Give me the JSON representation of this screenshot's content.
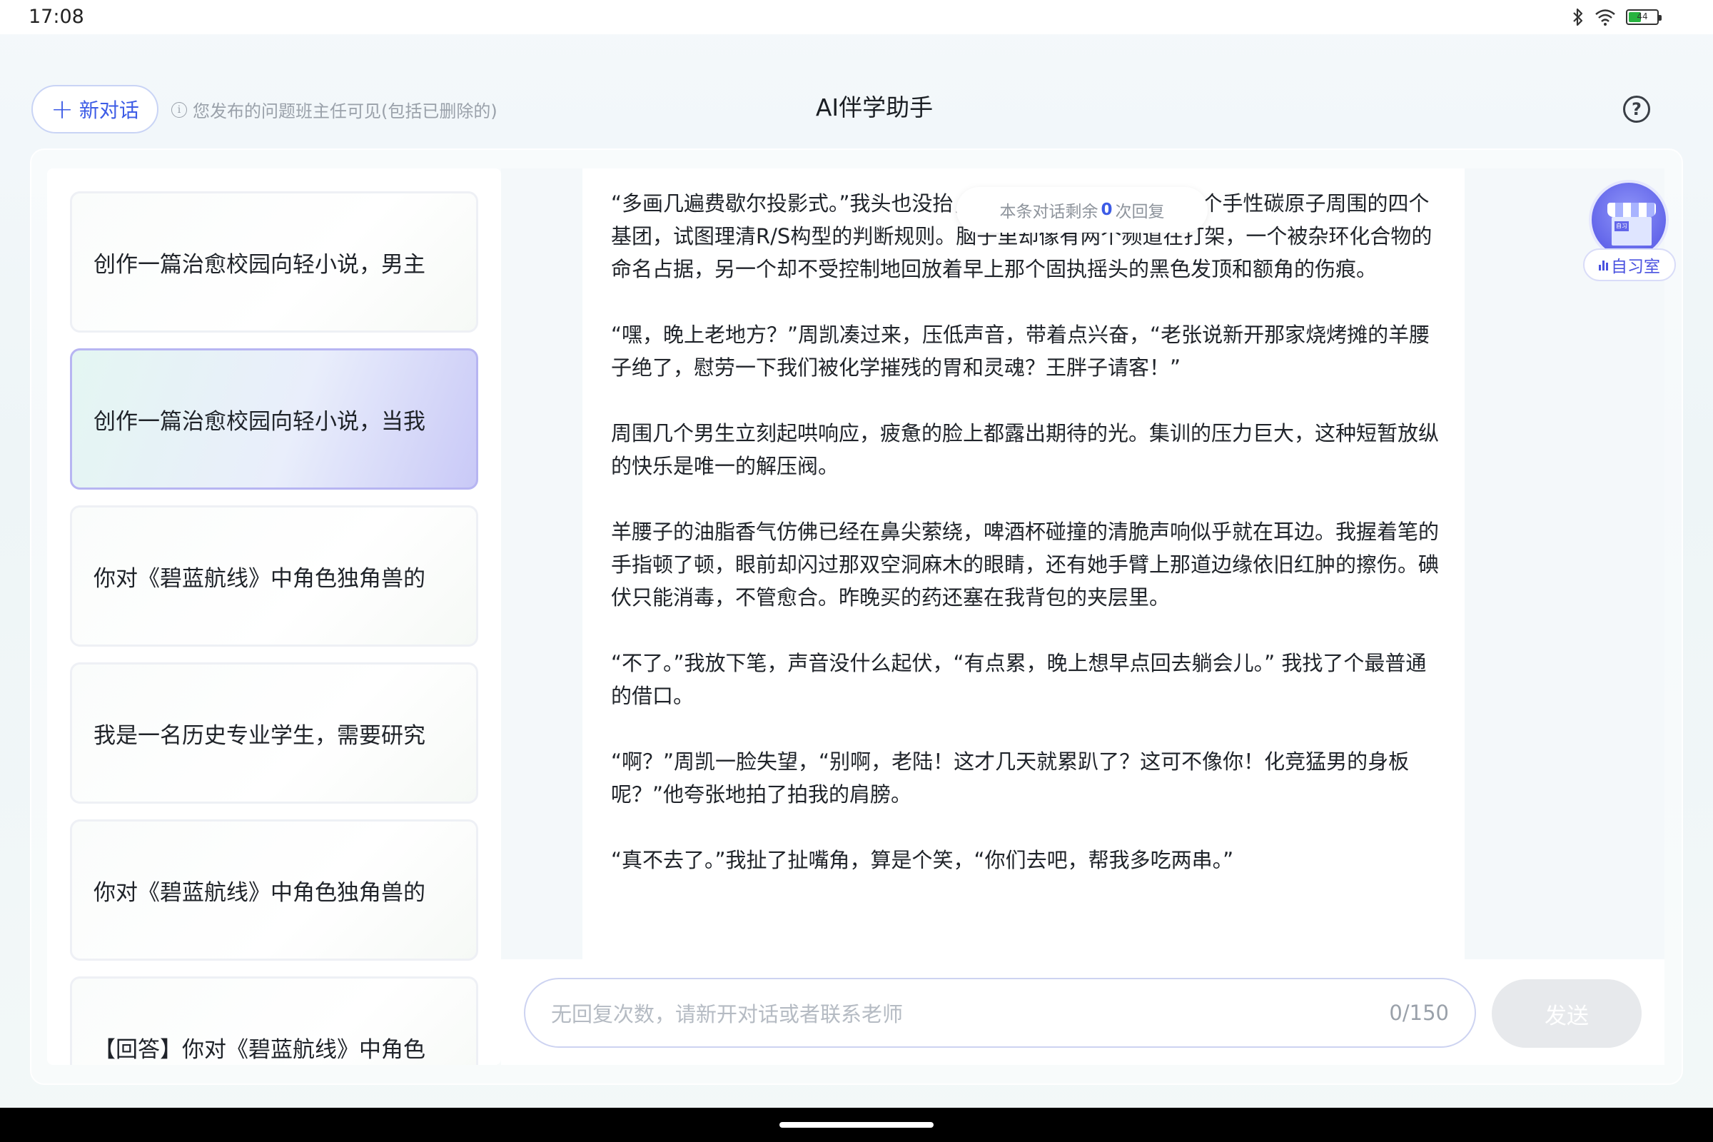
{
  "status_bar": {
    "time": "17:08",
    "battery_level": "44",
    "icons": [
      "bluetooth-icon",
      "wifi-icon",
      "battery-icon"
    ]
  },
  "header": {
    "new_chat_label": "新对话",
    "notice": "您发布的问题班主任可见(包括已删除的)",
    "title": "AI伴学助手",
    "help_symbol": "?"
  },
  "sidebar": {
    "items": [
      {
        "label": "创作一篇治愈校园向轻小说，男主",
        "active": false
      },
      {
        "label": "创作一篇治愈校园向轻小说，当我",
        "active": true
      },
      {
        "label": "你对《碧蓝航线》中角色独角兽的",
        "active": false
      },
      {
        "label": "我是一名历史专业学生，需要研究",
        "active": false
      },
      {
        "label": "你对《碧蓝航线》中角色独角兽的",
        "active": false
      },
      {
        "label": "【回答】你对《碧蓝航线》中角色",
        "active": false
      }
    ]
  },
  "remaining": {
    "prefix": "本条对话剩余",
    "count": "0",
    "suffix": "次回复"
  },
  "message": {
    "paragraphs": [
      "“多画几遍费歇尔投影式。”我头也没抬，笔尖在草稿纸上勾勒着一个手性碳原子周围的四个基团，试图理清R/S构型的判断规则。脑子里却像有两个频道在打架，一个被杂环化合物的命名占据，另一个却不受控制地回放着早上那个固执摇头的黑色发顶和额角的伤痕。",
      "“嘿，晚上老地方？”周凯凑过来，压低声音，带着点兴奋，“老张说新开那家烧烤摊的羊腰子绝了，慰劳一下我们被化学摧残的胃和灵魂？王胖子请客！”",
      "周围几个男生立刻起哄响应，疲惫的脸上都露出期待的光。集训的压力巨大，这种短暂放纵的快乐是唯一的解压阀。",
      "羊腰子的油脂香气仿佛已经在鼻尖萦绕，啤酒杯碰撞的清脆声响似乎就在耳边。我握着笔的手指顿了顿，眼前却闪过那双空洞麻木的眼睛，还有她手臂上那道边缘依旧红肿的擦伤。碘伏只能消毒，不管愈合。昨晚买的药还塞在我背包的夹层里。",
      "“不了。”我放下笔，声音没什么起伏，“有点累，晚上想早点回去躺会儿。” 我找了个最普通的借口。",
      "“啊？”周凯一脸失望，“别啊，老陆！这才几天就累趴了？这可不像你！化竞猛男的身板呢？”他夸张地拍了拍我的肩膀。",
      "“真不去了。”我扯了扯嘴角，算是个笑，“你们去吧，帮我多吃两串。”"
    ]
  },
  "input": {
    "placeholder": "无回复次数，请新开对话或者联系老师",
    "counter": "0/150",
    "send_label": "发送"
  },
  "study_room": {
    "label": "自习室",
    "sign": "自习"
  }
}
